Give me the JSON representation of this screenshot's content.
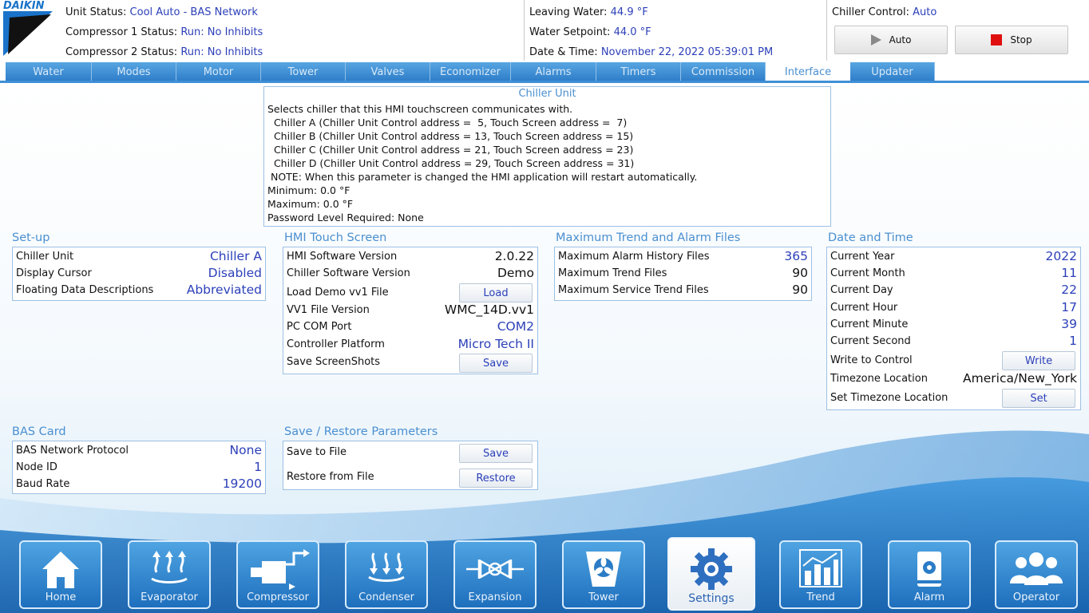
{
  "header": {
    "brand": "DAIKIN",
    "unit_status_label": "Unit Status:",
    "unit_status_value": "Cool Auto - BAS Network",
    "comp1_label": "Compressor 1 Status:",
    "comp1_value": "Run: No Inhibits",
    "comp2_label": "Compressor 2 Status:",
    "comp2_value": "Run: No Inhibits",
    "leaving_water_label": "Leaving Water:",
    "leaving_water_value": "44.9 °F",
    "water_setpoint_label": "Water Setpoint:",
    "water_setpoint_value": "44.0 °F",
    "datetime_label": "Date & Time:",
    "datetime_value": "November 22, 2022  05:39:01 PM",
    "chiller_control_label": "Chiller Control:",
    "chiller_control_value": "Auto",
    "auto_button": "Auto",
    "stop_button": "Stop"
  },
  "tabs": [
    "Water",
    "Modes",
    "Motor",
    "Tower",
    "Valves",
    "Economizer",
    "Alarms",
    "Timers",
    "Commission",
    "Interface",
    "Updater"
  ],
  "active_tab": "Interface",
  "info": {
    "title": "Chiller Unit",
    "lines": [
      "Selects chiller that this HMI touchscreen communicates with.",
      "  Chiller A (Chiller Unit Control address =  5, Touch Screen address =  7)",
      "  Chiller B (Chiller Unit Control address = 13, Touch Screen address = 15)",
      "  Chiller C (Chiller Unit Control address = 21, Touch Screen address = 23)",
      "  Chiller D (Chiller Unit Control address = 29, Touch Screen address = 31)",
      " NOTE: When this parameter is changed the HMI application will restart automatically.",
      "Minimum: 0.0 °F",
      "Maximum: 0.0 °F",
      "Password Level Required: None"
    ]
  },
  "setup": {
    "title": "Set-up",
    "rows": [
      {
        "label": "Chiller Unit",
        "value": "Chiller A"
      },
      {
        "label": "Display Cursor",
        "value": "Disabled"
      },
      {
        "label": "Floating Data Descriptions",
        "value": "Abbreviated"
      }
    ]
  },
  "hmi": {
    "title": "HMI Touch Screen",
    "sw_label": "HMI Software Version",
    "sw_value": "2.0.22",
    "csw_label": "Chiller Software Version",
    "csw_value": "Demo",
    "demo_label": "Load Demo vv1 File",
    "demo_button": "Load",
    "vv1_label": "VV1 File Version",
    "vv1_value": "WMC_14D.vv1",
    "com_label": "PC COM Port",
    "com_value": "COM2",
    "platform_label": "Controller Platform",
    "platform_value": "Micro Tech II",
    "shots_label": "Save ScreenShots",
    "shots_button": "Save"
  },
  "maxfiles": {
    "title": "Maximum Trend and Alarm Files",
    "rows": [
      {
        "label": "Maximum Alarm History Files",
        "value": "365"
      },
      {
        "label": "Maximum Trend Files",
        "value": "90"
      },
      {
        "label": "Maximum Service Trend Files",
        "value": "90"
      }
    ]
  },
  "datetime": {
    "title": "Date and Time",
    "rows": [
      {
        "label": "Current Year",
        "value": "2022"
      },
      {
        "label": "Current Month",
        "value": "11"
      },
      {
        "label": "Current Day",
        "value": "22"
      },
      {
        "label": "Current Hour",
        "value": "17"
      },
      {
        "label": "Current Minute",
        "value": "39"
      },
      {
        "label": "Current Second",
        "value": "1"
      }
    ],
    "write_label": "Write to Control",
    "write_button": "Write",
    "tz_label": "Timezone Location",
    "tz_value": "America/New_York",
    "settz_label": "Set Timezone Location",
    "settz_button": "Set"
  },
  "bas": {
    "title": "BAS Card",
    "rows": [
      {
        "label": "BAS Network Protocol",
        "value": "None"
      },
      {
        "label": "Node ID",
        "value": "1"
      },
      {
        "label": "Baud Rate",
        "value": "19200"
      }
    ]
  },
  "saverestore": {
    "title": "Save / Restore Parameters",
    "save_label": "Save to File",
    "save_button": "Save",
    "restore_label": "Restore from File",
    "restore_button": "Restore"
  },
  "nav": [
    "Home",
    "Evaporator",
    "Compressor",
    "Condenser",
    "Expansion",
    "Tower",
    "Settings",
    "Trend",
    "Alarm",
    "Operator"
  ],
  "active_nav": "Settings",
  "colors": {
    "accent_blue": "#2b3fb8",
    "tab_blue": "#3f8fd6",
    "title_blue": "#4a8fd0",
    "stop_red": "#e01010"
  }
}
